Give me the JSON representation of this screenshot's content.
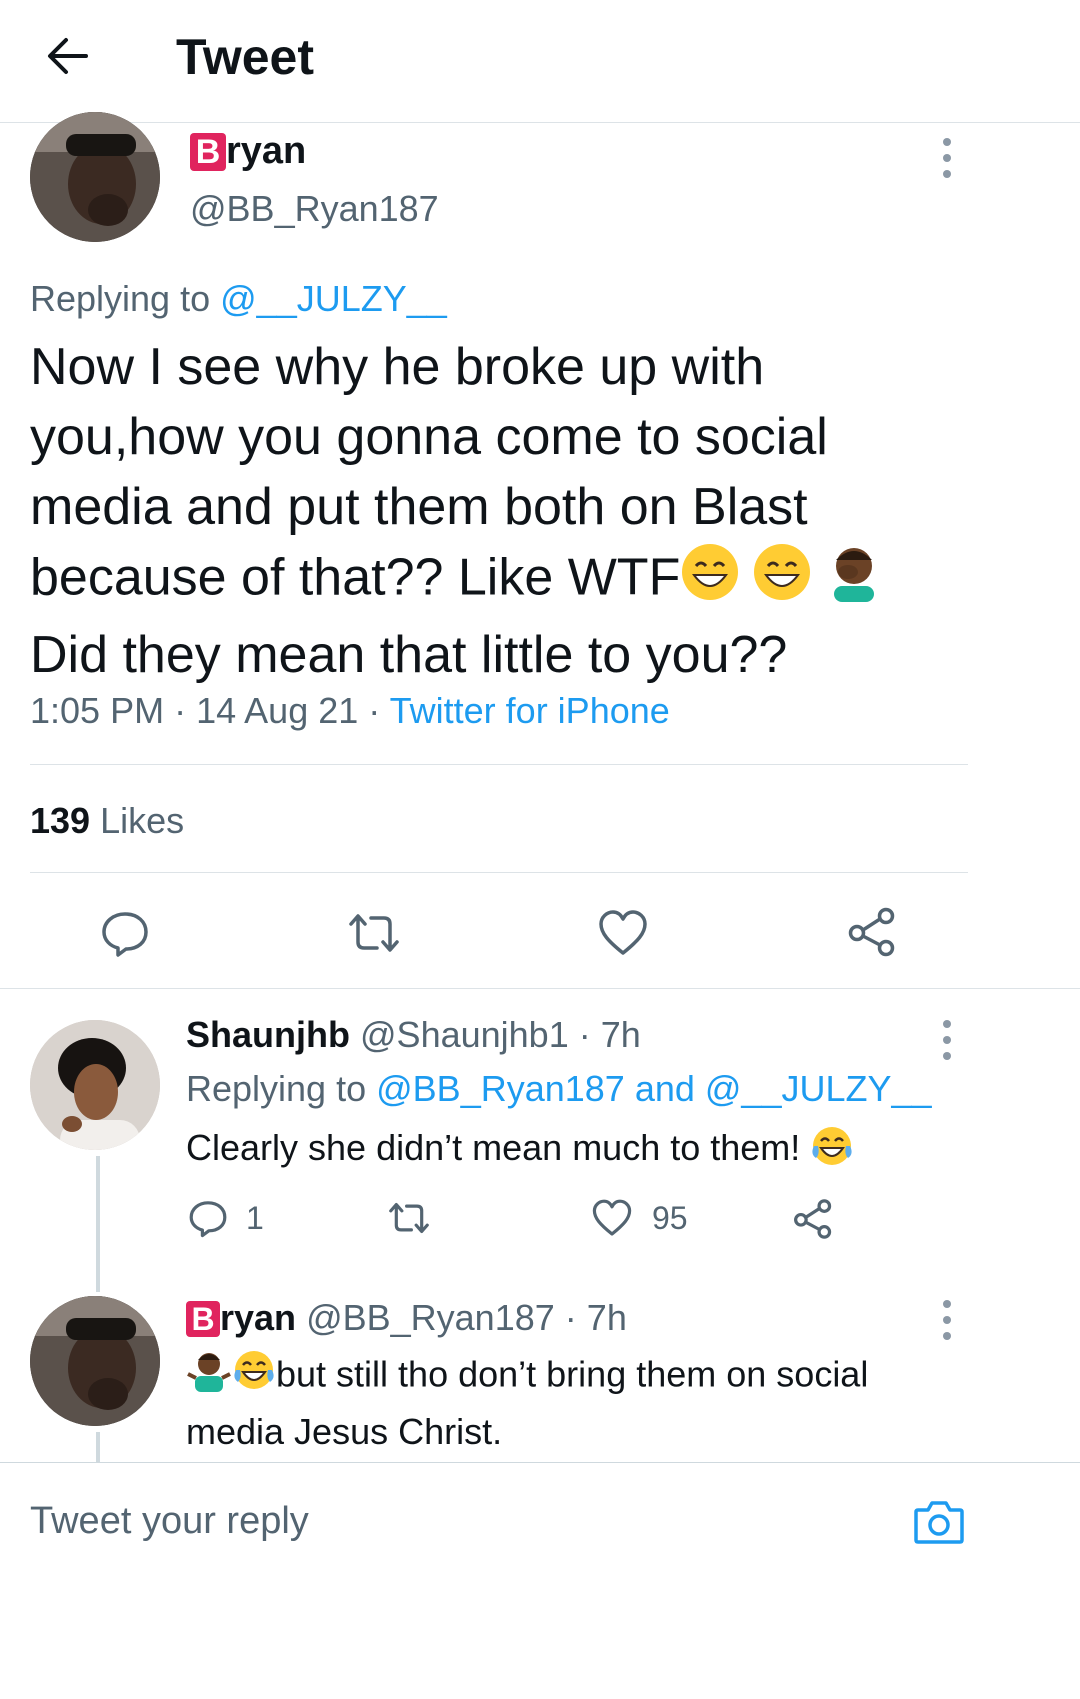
{
  "header": {
    "title": "Tweet"
  },
  "main_tweet": {
    "display_name_badge": "B",
    "display_name_rest": "ryan",
    "handle": "@BB_Ryan187",
    "replying_prefix": "Replying to",
    "replying_to": "@__JULZY__",
    "text_lines": [
      "Now I see why he broke up with",
      "you,how you gonna come to social",
      "media and put them both on Blast",
      "because of that?? Like WTF",
      "Did they mean that little to you??"
    ],
    "time": "1:05 PM",
    "date": "14 Aug 21",
    "source": "Twitter for iPhone",
    "separator": "·",
    "likes_count": "139",
    "likes_label": "Likes"
  },
  "replies": [
    {
      "display_name": "Shaunjhb",
      "handle": "@Shaunjhb1",
      "time": "7h",
      "separator": "·",
      "replying_prefix": "Replying to",
      "replying_to": "@BB_Ryan187 and @__JULZY__",
      "text": "Clearly she didn’t mean much to them!",
      "reply_count": "1",
      "like_count": "95"
    },
    {
      "display_name_badge": "B",
      "display_name_rest": "ryan",
      "handle": "@BB_Ryan187",
      "time": "7h",
      "separator": "·",
      "text_line1": "but still tho don’t bring them on social",
      "text_line2": "media Jesus Christ."
    }
  ],
  "composer": {
    "placeholder": "Tweet your reply"
  },
  "colors": {
    "accent": "#1d9bf0",
    "badge": "#e0245e",
    "text": "#0f1419",
    "muted": "#536471",
    "divider": "#dde3e7"
  },
  "icons": [
    "back-arrow-icon",
    "more-vertical-icon",
    "reply-icon",
    "retweet-icon",
    "like-icon",
    "share-icon",
    "camera-icon",
    "grinning-emoji-icon",
    "facepalm-emoji-icon",
    "tears-of-joy-emoji-icon",
    "shrug-emoji-icon"
  ]
}
